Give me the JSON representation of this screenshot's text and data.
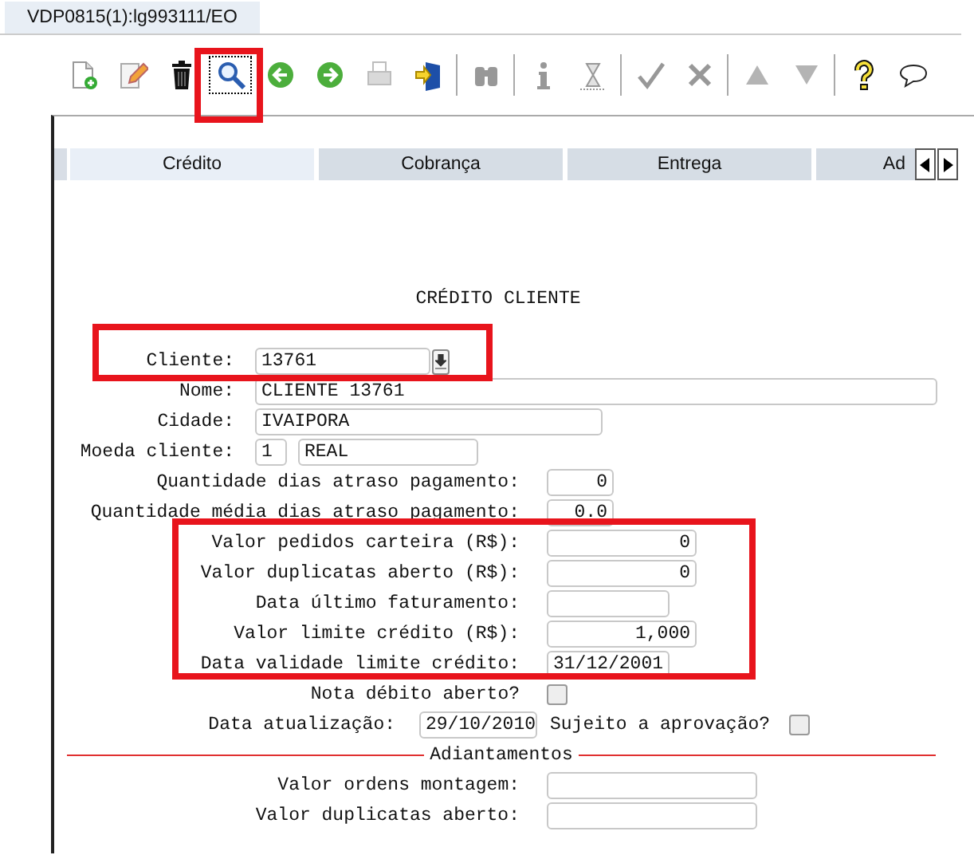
{
  "window_tab": {
    "label": "VDP0815(1):lg993111/EO"
  },
  "toolbar": [
    [
      {
        "kind": "new",
        "disabled": false,
        "selected": false
      },
      {
        "kind": "edit",
        "disabled": false,
        "selected": false
      },
      {
        "kind": "delete",
        "disabled": false,
        "selected": false
      },
      {
        "kind": "search",
        "disabled": false,
        "selected": true
      },
      {
        "kind": "previous",
        "disabled": false,
        "selected": false
      },
      {
        "kind": "next",
        "disabled": false,
        "selected": false
      },
      {
        "kind": "print",
        "disabled": true,
        "selected": false
      },
      {
        "kind": "exit",
        "disabled": false,
        "selected": false
      }
    ],
    [
      {
        "kind": "find",
        "disabled": true,
        "selected": false
      }
    ],
    [
      {
        "kind": "info",
        "disabled": true,
        "selected": false
      },
      {
        "kind": "hourglass",
        "disabled": true,
        "selected": false
      }
    ],
    [
      {
        "kind": "confirm",
        "disabled": true,
        "selected": false
      },
      {
        "kind": "cancel",
        "disabled": true,
        "selected": false
      }
    ],
    [
      {
        "kind": "up",
        "disabled": true,
        "selected": false
      },
      {
        "kind": "down",
        "disabled": true,
        "selected": false
      }
    ],
    [
      {
        "kind": "help",
        "disabled": false,
        "selected": false
      },
      {
        "kind": "comment",
        "disabled": false,
        "selected": false
      }
    ]
  ],
  "tabs": [
    {
      "label": "Crédito",
      "selected": true
    },
    {
      "label": "Cobrança",
      "selected": false
    },
    {
      "label": "Entrega",
      "selected": false
    },
    {
      "label": "Ad",
      "selected": false
    }
  ],
  "form": {
    "title": "CRÉDITO CLIENTE",
    "customer": {
      "label": "Cliente:",
      "value": "13761"
    },
    "name": {
      "label": "Nome:",
      "value": "CLIENTE 13761"
    },
    "city": {
      "label": "Cidade:",
      "value": "IVAIPORA"
    },
    "currency": {
      "label": "Moeda cliente:",
      "code": "1",
      "value": "REAL"
    },
    "rows": [
      {
        "kind": "number",
        "label": "Quantidade dias atraso pagamento:",
        "value": "0"
      },
      {
        "kind": "number",
        "label": "Quantidade média dias atraso pagamento:",
        "value": "0.0"
      },
      {
        "kind": "number",
        "label": "Valor pedidos carteira (R$):",
        "value": "0"
      },
      {
        "kind": "number",
        "label": "Valor duplicatas aberto (R$):",
        "value": "0"
      },
      {
        "kind": "text",
        "label": "Data último faturamento:"
      },
      {
        "kind": "number",
        "label": "Valor limite crédito (R$):",
        "value": "1,000"
      },
      {
        "kind": "text",
        "label": "Data validade limite crédito:",
        "value": "31/12/2001"
      },
      {
        "kind": "checkbox",
        "label": "Nota débito aberto?",
        "checked": false
      }
    ],
    "update": {
      "label": "Data atualização:",
      "value": "29/10/2010",
      "check_label": "Sujeito a aprovação?",
      "checked": false
    },
    "advances": {
      "title": "Adiantamentos",
      "rows": [
        {
          "kind": "text",
          "label": "Valor ordens montagem:"
        },
        {
          "kind": "text",
          "label": "Valor duplicatas aberto:"
        }
      ]
    }
  }
}
